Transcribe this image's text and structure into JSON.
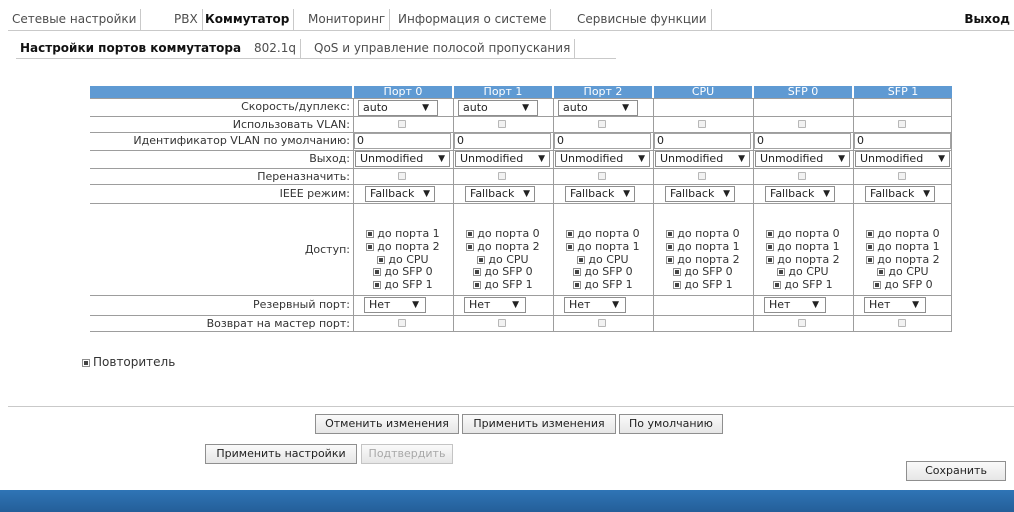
{
  "nav": {
    "tabs": [
      "Сетевые настройки",
      "PBX",
      "Коммутатор",
      "Мониторинг",
      "Информация о системе",
      "Сервисные функции"
    ],
    "active": "Коммутатор",
    "exit": "Выход"
  },
  "subnav": {
    "tabs": [
      "Настройки портов коммутатора",
      "802.1q",
      "QoS и управление полосой пропускания"
    ]
  },
  "table": {
    "columns": [
      "Порт 0",
      "Порт 1",
      "Порт 2",
      "CPU",
      "SFP 0",
      "SFP 1"
    ],
    "rows": {
      "speed": "Скорость/дуплекс:",
      "use_vlan": "Использовать VLAN:",
      "vlan_id": "Идентификатор VLAN по умолчанию:",
      "egress": "Выход:",
      "reassign": "Переназначить:",
      "ieee": "IEEE режим:",
      "access": "Доступ:",
      "backup": "Резервный порт:",
      "master_return": "Возврат на мастер порт:"
    },
    "speed_values": [
      "auto",
      "auto",
      "auto"
    ],
    "vlan_ids": [
      "0",
      "0",
      "0",
      "0",
      "0",
      "0"
    ],
    "egress_values": [
      "Unmodified",
      "Unmodified",
      "Unmodified",
      "Unmodified",
      "Unmodified",
      "Unmodified"
    ],
    "ieee_values": [
      "Fallback",
      "Fallback",
      "Fallback",
      "Fallback",
      "Fallback",
      "Fallback"
    ],
    "access": [
      [
        "до порта 1",
        "до порта 2",
        "до CPU",
        "до SFP 0",
        "до SFP 1"
      ],
      [
        "до порта 0",
        "до порта 2",
        "до CPU",
        "до SFP 0",
        "до SFP 1"
      ],
      [
        "до порта 0",
        "до порта 1",
        "до CPU",
        "до SFP 0",
        "до SFP 1"
      ],
      [
        "до порта 0",
        "до порта 1",
        "до порта 2",
        "до SFP 0",
        "до SFP 1"
      ],
      [
        "до порта 0",
        "до порта 1",
        "до порта 2",
        "до CPU",
        "до SFP 1"
      ],
      [
        "до порта 0",
        "до порта 1",
        "до порта 2",
        "до CPU",
        "до SFP 0"
      ]
    ],
    "backup_values": [
      "Нет",
      "Нет",
      "Нет",
      "",
      "Нет",
      "Нет"
    ]
  },
  "repeater": {
    "label": "Повторитель",
    "checked": true
  },
  "buttons": {
    "cancel": "Отменить изменения",
    "apply_changes": "Применить изменения",
    "defaults": "По умолчанию",
    "apply_settings": "Применить настройки",
    "confirm": "Подтвердить",
    "save": "Сохранить"
  },
  "colors": {
    "header": "#5f9ad3",
    "footer": "#2f75b6"
  }
}
